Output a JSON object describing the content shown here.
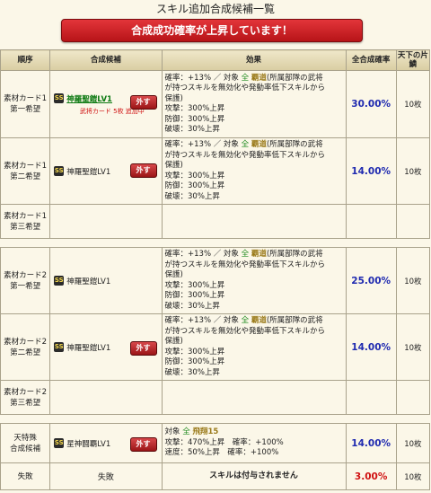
{
  "page": {
    "title": "スキル追加合成候補一覧",
    "banner": "合成成功確率が上昇しています！"
  },
  "headers": {
    "order": "順序",
    "candidate": "合成候補",
    "effect": "効果",
    "rate": "全合成確率",
    "count": "天下の片鱗"
  },
  "common_effect": {
    "line1_prefix": "確率：+13% ／ 対象",
    "line1_all": "全",
    "line1_skill": "覇道",
    "line1_rest": "(所属部隊の武将",
    "line2": "が持つスキルを無効化や発動率低下スキルから",
    "line3": "保護)",
    "line4": "攻撃：300%上昇",
    "line5": "防御：300%上昇",
    "line6": "破壊：30%上昇"
  },
  "rows": [
    {
      "order1": "素材カード1",
      "order2": "第一希望",
      "rank": "SS",
      "skill": "神羅聖鎧LV1",
      "remove": "外す",
      "note": "武将カード 5枚 追加中",
      "rate": "30.00%",
      "count": "10枚"
    },
    {
      "order1": "素材カード1",
      "order2": "第二希望",
      "rank": "SS",
      "skill": "神羅聖鎧LV1",
      "remove": "外す",
      "rate": "14.00%",
      "count": "10枚"
    },
    {
      "order1": "素材カード1",
      "order2": "第三希望"
    },
    {
      "order1": "素材カード2",
      "order2": "第一希望",
      "rank": "SS",
      "skill": "神羅聖鎧LV1",
      "remove": "外す",
      "rate": "25.00%",
      "count": "10枚"
    },
    {
      "order1": "素材カード2",
      "order2": "第二希望",
      "rank": "SS",
      "skill": "神羅聖鎧LV1",
      "remove": "外す",
      "rate": "14.00%",
      "count": "10枚"
    },
    {
      "order1": "素材カード2",
      "order2": "第三希望"
    },
    {
      "order1": "天特殊",
      "order2": "合成候補",
      "rank": "SS",
      "skill": "星神闘覇LV1",
      "remove": "外す",
      "effect_line1_prefix": "対象",
      "effect_line1_all": "全",
      "effect_line1_skill": "飛翔15",
      "effect_line2": "攻撃：470%上昇　確率：+100%",
      "effect_line3": "速度：50%上昇　確率：+100%",
      "rate": "14.00%",
      "count": "10枚"
    },
    {
      "order1": "失敗",
      "candidate": "失敗",
      "effect": "スキルは付与されません",
      "rate": "3.00%",
      "count": "10枚"
    }
  ],
  "colors": {
    "banner": "#c8191d",
    "rate_blue": "#1f2ab0",
    "rate_red": "#d01212"
  }
}
